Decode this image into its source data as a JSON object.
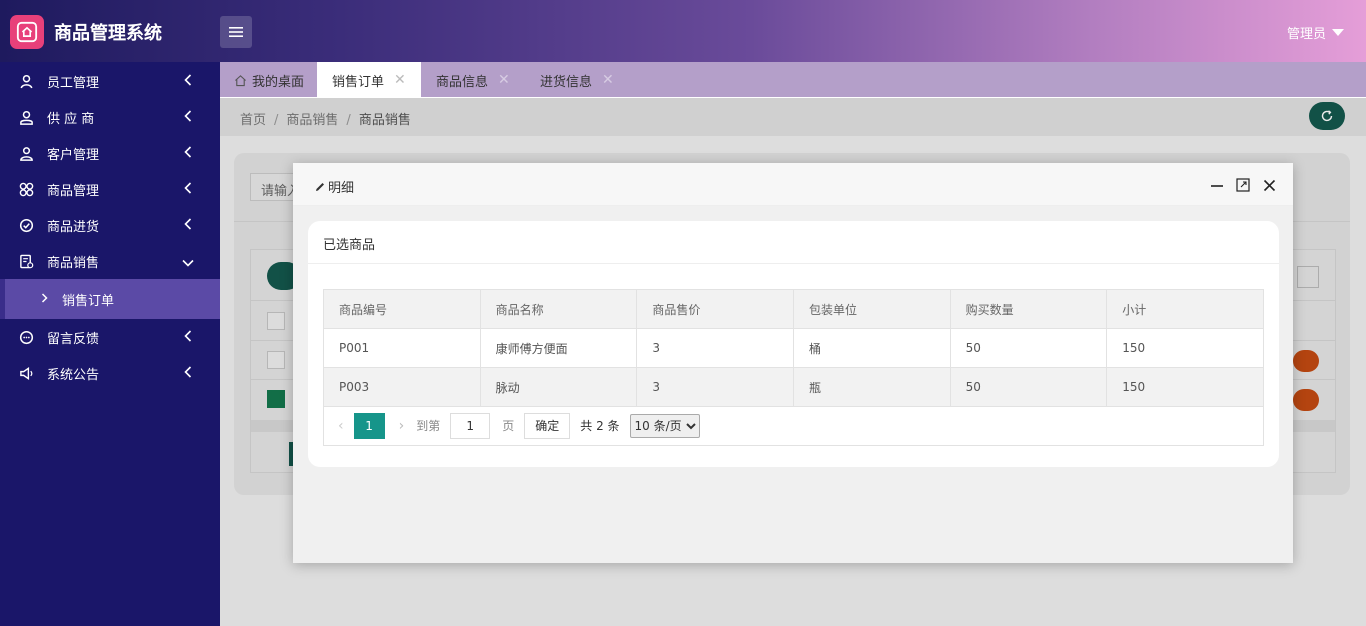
{
  "app": {
    "title": "商品管理系统",
    "user": "管理员"
  },
  "sidebar": {
    "items": [
      {
        "label": "员工管理",
        "icon": "user-tie-icon"
      },
      {
        "label": "供 应 商",
        "icon": "person-icon"
      },
      {
        "label": "客户管理",
        "icon": "users-icon"
      },
      {
        "label": "商品管理",
        "icon": "grid-icon"
      },
      {
        "label": "商品进货",
        "icon": "check-circle-icon"
      },
      {
        "label": "商品销售",
        "icon": "receipt-icon",
        "expanded": true
      },
      {
        "label": "留言反馈",
        "icon": "message-icon"
      },
      {
        "label": "系统公告",
        "icon": "megaphone-icon"
      }
    ],
    "sub_item": "销售订单"
  },
  "tabs": [
    {
      "label": "我的桌面"
    },
    {
      "label": "销售订单",
      "active": true
    },
    {
      "label": "商品信息"
    },
    {
      "label": "进货信息"
    }
  ],
  "breadcrumb": {
    "home": "首页",
    "section": "商品销售",
    "current": "商品销售"
  },
  "background": {
    "search_placeholder": "请输入"
  },
  "modal": {
    "title": "明细",
    "panel_title": "已选商品",
    "table": {
      "headers": [
        "商品编号",
        "商品名称",
        "商品售价",
        "包装单位",
        "购买数量",
        "小计"
      ],
      "rows": [
        [
          "P001",
          "康师傅方便面",
          "3",
          "桶",
          "50",
          "150"
        ],
        [
          "P003",
          "脉动",
          "3",
          "瓶",
          "50",
          "150"
        ]
      ]
    },
    "pager": {
      "current_page": "1",
      "goto_label": "到第",
      "page_input": "1",
      "page_unit": "页",
      "confirm": "确定",
      "total": "共 2 条",
      "page_size": "10 条/页"
    }
  },
  "colors": {
    "sidebar": "#1a1669",
    "accent": "#16958a",
    "brand": "#e8407a"
  }
}
